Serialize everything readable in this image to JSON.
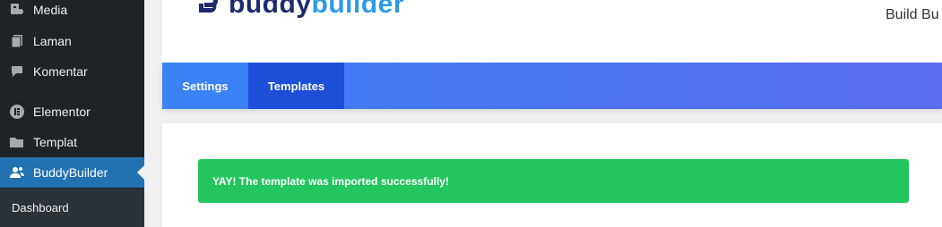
{
  "sidebar": {
    "items": [
      {
        "label": "Media",
        "icon": "media-icon"
      },
      {
        "label": "Laman",
        "icon": "pages-icon"
      },
      {
        "label": "Komentar",
        "icon": "comment-icon"
      },
      {
        "label": "Elementor",
        "icon": "elementor-icon"
      },
      {
        "label": "Templat",
        "icon": "folder-icon"
      },
      {
        "label": "BuddyBuilder",
        "icon": "users-icon",
        "active": true
      }
    ],
    "submenu": [
      "Dashboard"
    ]
  },
  "header": {
    "logo_part1": "buddy",
    "logo_part2": "builder",
    "tagline": "Build Bu"
  },
  "tabs": [
    {
      "label": "Settings",
      "active": false
    },
    {
      "label": "Templates",
      "active": true
    }
  ],
  "notice": {
    "message": "YAY! The template was imported successfully!",
    "color": "#22c55e"
  },
  "colors": {
    "sidebar_bg": "#1d2327",
    "active_menu": "#2271b1",
    "tab_active": "#1d4ed8",
    "tab_bar": "#3b82f6"
  }
}
